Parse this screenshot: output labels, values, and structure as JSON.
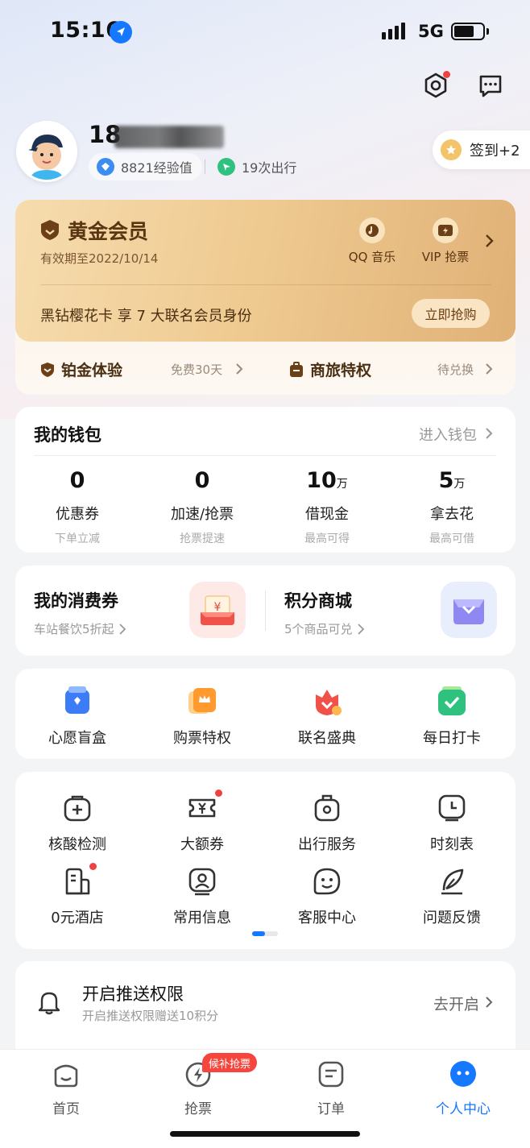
{
  "status_bar": {
    "time": "15:16",
    "network": "5G"
  },
  "profile": {
    "phone_prefix": "18",
    "experience": "8821经验值",
    "trips": "19次出行",
    "signin_label": "签到+2"
  },
  "membership": {
    "title": "黄金会员",
    "valid_until": "有效期至2022/10/14",
    "perks": [
      "QQ 音乐",
      "VIP 抢票"
    ],
    "promo": "黑钻樱花卡 享 7 大联名会员身份",
    "buy_label": "立即抢购",
    "platinum_label": "铂金体验",
    "platinum_note": "免费30天",
    "business_label": "商旅特权",
    "business_note": "待兑换"
  },
  "wallet": {
    "title": "我的钱包",
    "link": "进入钱包",
    "items": [
      {
        "value": "0",
        "unit": "",
        "label": "优惠券",
        "note": "下单立减"
      },
      {
        "value": "0",
        "unit": "",
        "label": "加速/抢票",
        "note": "抢票提速"
      },
      {
        "value": "10",
        "unit": "万",
        "label": "借现金",
        "note": "最高可得"
      },
      {
        "value": "5",
        "unit": "万",
        "label": "拿去花",
        "note": "最高可借"
      }
    ]
  },
  "coupons": {
    "my_title": "我的消费券",
    "my_sub": "车站餐饮5折起",
    "mall_title": "积分商城",
    "mall_sub": "5个商品可兑"
  },
  "quick": [
    "心愿盲盒",
    "购票特权",
    "联名盛典",
    "每日打卡"
  ],
  "services": [
    "核酸检测",
    "大额券",
    "出行服务",
    "时刻表",
    "0元酒店",
    "常用信息",
    "客服中心",
    "问题反馈"
  ],
  "push": {
    "title": "开启推送权限",
    "sub": "开启推送权限赠送10积分",
    "action": "去开启"
  },
  "tabs": [
    "首页",
    "抢票",
    "订单",
    "个人中心"
  ],
  "tab_badge": "候补抢票",
  "colors": {
    "accent": "#1677ff",
    "gold": "#efcb92",
    "badge_red": "#f5453d"
  }
}
